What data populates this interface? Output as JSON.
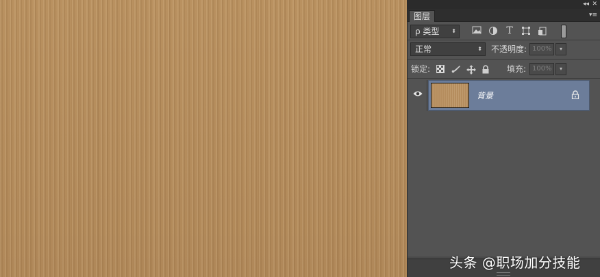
{
  "panel": {
    "tab_label": "图层",
    "collapse_glyph": "◂◂",
    "close_glyph": "✕",
    "menu_glyph": "▾≡"
  },
  "filter": {
    "kind_label": "ρ 类型",
    "kind_arrow": "⬍",
    "icons": [
      "image-filter-icon",
      "adjustment-filter-icon",
      "type-filter-icon",
      "shape-filter-icon",
      "smart-object-filter-icon"
    ]
  },
  "blend": {
    "mode": "正常",
    "opacity_label": "不透明度:",
    "opacity_value": "100%"
  },
  "lock": {
    "label": "锁定:",
    "fill_label": "填充:",
    "fill_value": "100%"
  },
  "layers": [
    {
      "name": "背景",
      "visible": true,
      "locked": true
    }
  ],
  "watermark": "头条 @职场加分技能",
  "colors": {
    "canvas": "#b58d5e",
    "selected_layer": "#6c7d9a",
    "panel_bg": "#535353"
  }
}
